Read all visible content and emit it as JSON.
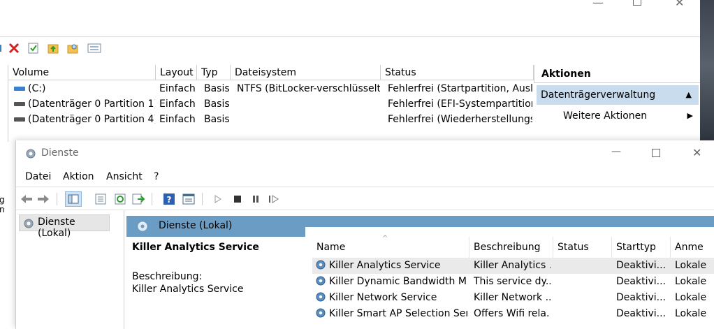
{
  "disk_mgmt": {
    "columns": [
      "Volume",
      "Layout",
      "Typ",
      "Dateisystem",
      "Status"
    ],
    "rows": [
      {
        "volume": "(C:)",
        "layout": "Einfach",
        "typ": "Basis",
        "fs": "NTFS (BitLocker-verschlüsselt)",
        "status": "Fehlerfrei (Startpartition, Auslag"
      },
      {
        "volume": "(Datenträger 0 Partition 1)",
        "layout": "Einfach",
        "typ": "Basis",
        "fs": "",
        "status": "Fehlerfrei (EFI-Systempartition)"
      },
      {
        "volume": "(Datenträger 0 Partition 4)",
        "layout": "Einfach",
        "typ": "Basis",
        "fs": "",
        "status": "Fehlerfrei (Wiederherstellungsp"
      }
    ],
    "actions": {
      "header": "Aktionen",
      "section": "Datenträgerverwaltung",
      "more": "Weitere Aktionen"
    },
    "edge_fragments": [
      "g",
      "n"
    ]
  },
  "services": {
    "window_title": "Dienste",
    "menu": [
      "Datei",
      "Aktion",
      "Ansicht",
      "?"
    ],
    "tree_item": "Dienste (Lokal)",
    "header_title": "Dienste (Lokal)",
    "selected_name": "Killer Analytics Service",
    "description_label": "Beschreibung:",
    "description_text": "Killer Analytics Service",
    "columns": [
      "Name",
      "Beschreibung",
      "Status",
      "Starttyp",
      "Anme"
    ],
    "rows": [
      {
        "name": "Killer Analytics Service",
        "desc": "Killer Analytics ...",
        "status": "",
        "start": "Deaktivi...",
        "logon": "Lokale"
      },
      {
        "name": "Killer Dynamic Bandwidth M...",
        "desc": "This service dy...",
        "status": "",
        "start": "Deaktivi...",
        "logon": "Lokale"
      },
      {
        "name": "Killer Network Service",
        "desc": "Killer Network ...",
        "status": "",
        "start": "Deaktivi...",
        "logon": "Lokale"
      },
      {
        "name": "Killer Smart AP Selection Ser...",
        "desc": "Offers Wifi rela...",
        "status": "",
        "start": "Deaktivi...",
        "logon": "Lokale"
      }
    ]
  },
  "colors": {
    "detail_header": "#6b9cc4",
    "actions_section": "#c9dcee",
    "selected_row": "#eaeaea"
  }
}
